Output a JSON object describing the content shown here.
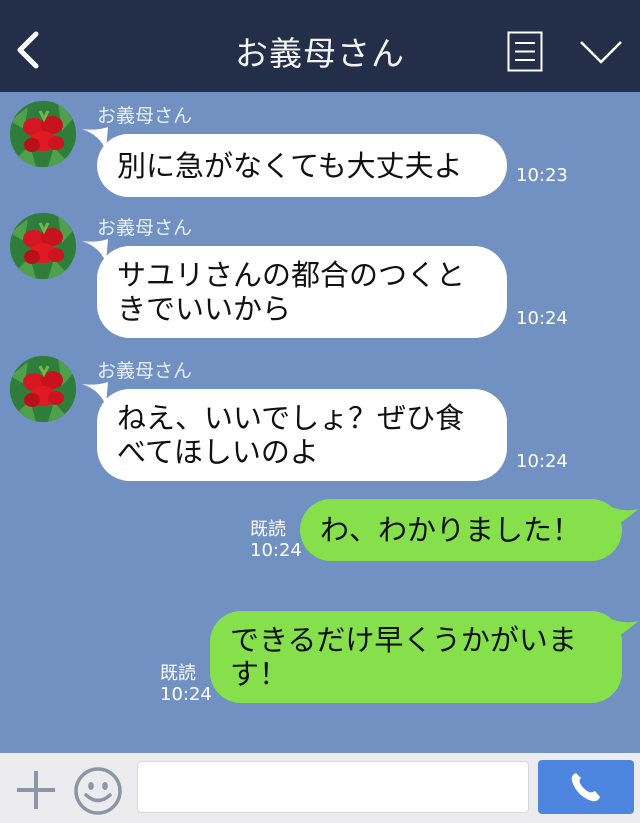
{
  "header": {
    "title": "お義母さん",
    "icons": [
      "back-chevron-icon",
      "menu-list-icon",
      "chevron-down-icon"
    ],
    "bg": "#232e48"
  },
  "chat_bg": "#7191c3",
  "messages": [
    {
      "dir": "in",
      "sender": "お義母さん",
      "lines": [
        "別に急がなくても大丈夫よ"
      ],
      "time": "10:23"
    },
    {
      "dir": "in",
      "sender": "お義母さん",
      "lines": [
        "サユリさんの都合のつくと",
        "きでいいから"
      ],
      "time": "10:24"
    },
    {
      "dir": "in",
      "sender": "お義母さん",
      "lines": [
        "ねえ、いいでしょ？ぜひ食",
        "べてほしいのよ"
      ],
      "time": "10:24"
    },
    {
      "dir": "out",
      "read": "既読",
      "lines": [
        "わ、わかりました！"
      ],
      "time": "10:24"
    },
    {
      "dir": "out",
      "read": "既読",
      "lines": [
        "できるだけ早くうかがいま",
        "す！"
      ],
      "time": "10:24"
    }
  ],
  "footer": {
    "input_placeholder": "",
    "icons": [
      "plus-icon",
      "smiley-icon",
      "phone-icon"
    ],
    "call_color": "#4e86df"
  },
  "colors": {
    "bubble_in": "#ffffff",
    "bubble_out": "#86e04c"
  }
}
